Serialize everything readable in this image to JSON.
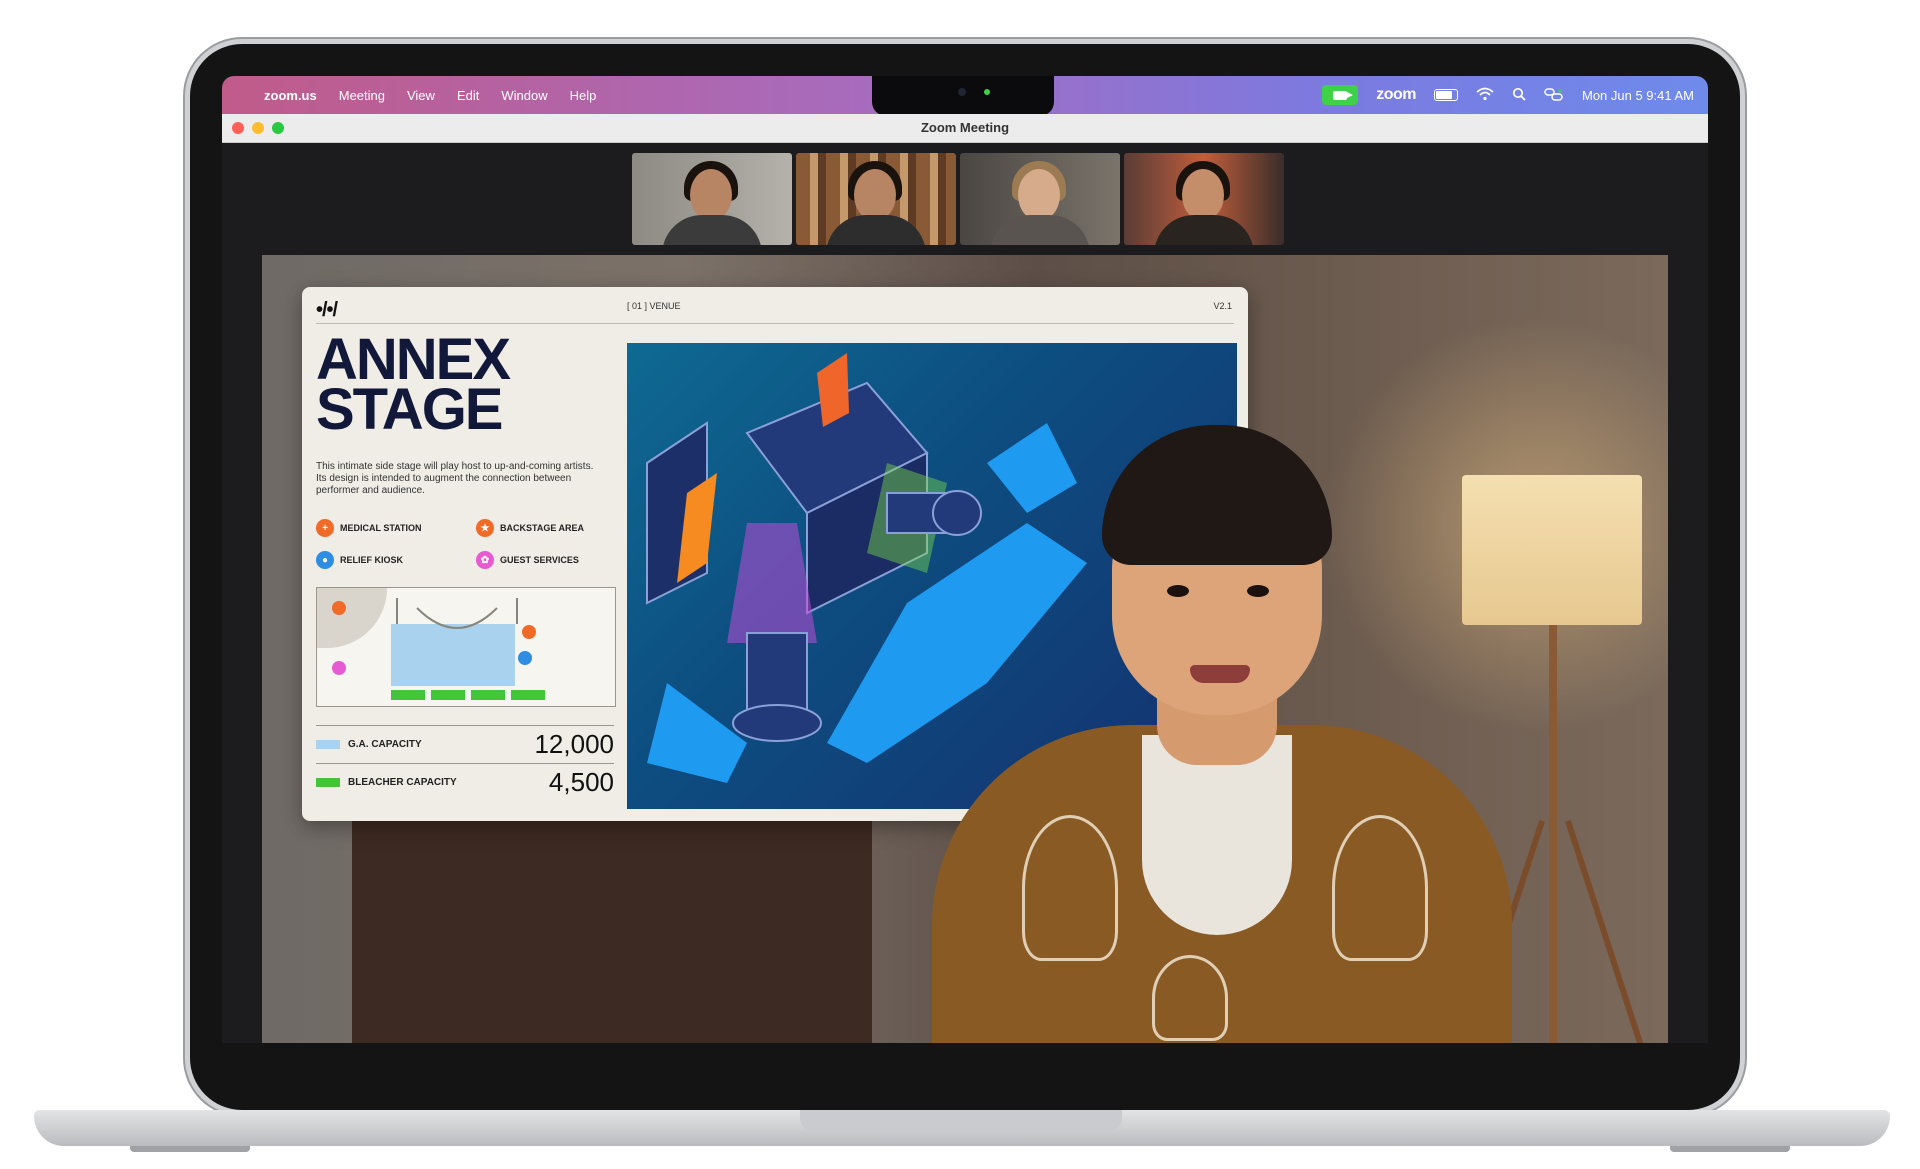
{
  "menubar": {
    "app_name": "zoom.us",
    "items": [
      "Meeting",
      "View",
      "Edit",
      "Window",
      "Help"
    ],
    "brand": "zoom",
    "datetime": "Mon Jun 5  9:41 AM"
  },
  "window": {
    "title": "Zoom Meeting"
  },
  "participants": [
    {
      "name": "participant-1"
    },
    {
      "name": "participant-2"
    },
    {
      "name": "participant-3"
    },
    {
      "name": "participant-4"
    }
  ],
  "shared_panel": {
    "logo": "•/•/",
    "section": "[ 01 ]  VENUE",
    "version": "V2.1",
    "title_line1": "ANNEX",
    "title_line2": "STAGE",
    "description": "This intimate side stage will play host to up-and-coming artists. Its design is intended to augment the connection between performer and audience.",
    "legend": [
      {
        "label": "MEDICAL STATION",
        "color": "#f06a28",
        "glyph": "+"
      },
      {
        "label": "BACKSTAGE AREA",
        "color": "#f06a28",
        "glyph": "★"
      },
      {
        "label": "RELIEF KIOSK",
        "color": "#2f8de4",
        "glyph": "●"
      },
      {
        "label": "GUEST SERVICES",
        "color": "#e65bd1",
        "glyph": "✿"
      }
    ],
    "capacities": [
      {
        "label": "G.A. CAPACITY",
        "value": "12,000",
        "color": "#a8d2ee"
      },
      {
        "label": "BLEACHER CAPACITY",
        "value": "4,500",
        "color": "#42c637"
      }
    ]
  },
  "colors": {
    "menubar_start": "#c05b8a",
    "menubar_end": "#6e8bea",
    "zoom_green": "#3fd14a",
    "panel_bg": "#f0ede6",
    "title_navy": "#12183a"
  }
}
